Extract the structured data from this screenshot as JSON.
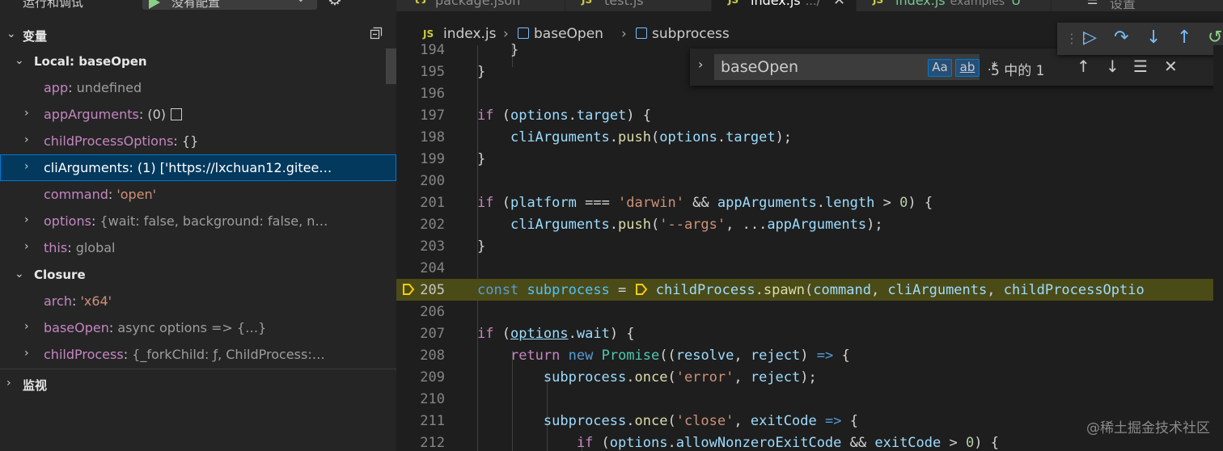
{
  "run": {
    "label": "运行和调试",
    "config": "没有配置"
  },
  "variables": {
    "title": "变量",
    "scope_local": "Local: baseOpen",
    "local": [
      {
        "name": "app",
        "value": "undefined"
      },
      {
        "name": "appArguments",
        "value": "(0)"
      },
      {
        "name": "childProcessOptions",
        "value": "{}"
      },
      {
        "name": "cliArguments",
        "value": "(1) ['https://lxchuan12.gitee…"
      },
      {
        "name": "command",
        "value": "'open'"
      },
      {
        "name": "options",
        "value": "{wait: false, background: false, n…"
      },
      {
        "name": "this",
        "value": "global"
      }
    ],
    "scope_closure": "Closure",
    "closure": [
      {
        "name": "arch",
        "value": "'x64'"
      },
      {
        "name": "baseOpen",
        "value": "async options => {…}"
      },
      {
        "name": "childProcess",
        "value": "{_forkChild: ƒ, ChildProcess:…"
      }
    ]
  },
  "watch": {
    "title": "监视"
  },
  "tabs": [
    {
      "label": "package.json"
    },
    {
      "label": "test.js"
    },
    {
      "label": "index.js",
      "desc": "…/",
      "active": true
    },
    {
      "label": "index.js",
      "desc": "examples",
      "count": "U"
    },
    {
      "label": "设置"
    }
  ],
  "breadcrumb": {
    "file": "index.js",
    "fn": "baseOpen",
    "var": "subprocess"
  },
  "find": {
    "value": "baseOpen",
    "case_label": "Aa",
    "word_label": "ab",
    "regex_label": ".*",
    "count": "5 中的 1"
  },
  "code_lines": [
    "194",
    "195",
    "196",
    "197",
    "198",
    "199",
    "200",
    "201",
    "202",
    "203",
    "204",
    "205",
    "206",
    "207",
    "208",
    "209",
    "210",
    "211",
    "212"
  ],
  "watermark": "@稀土掘金技术社区"
}
